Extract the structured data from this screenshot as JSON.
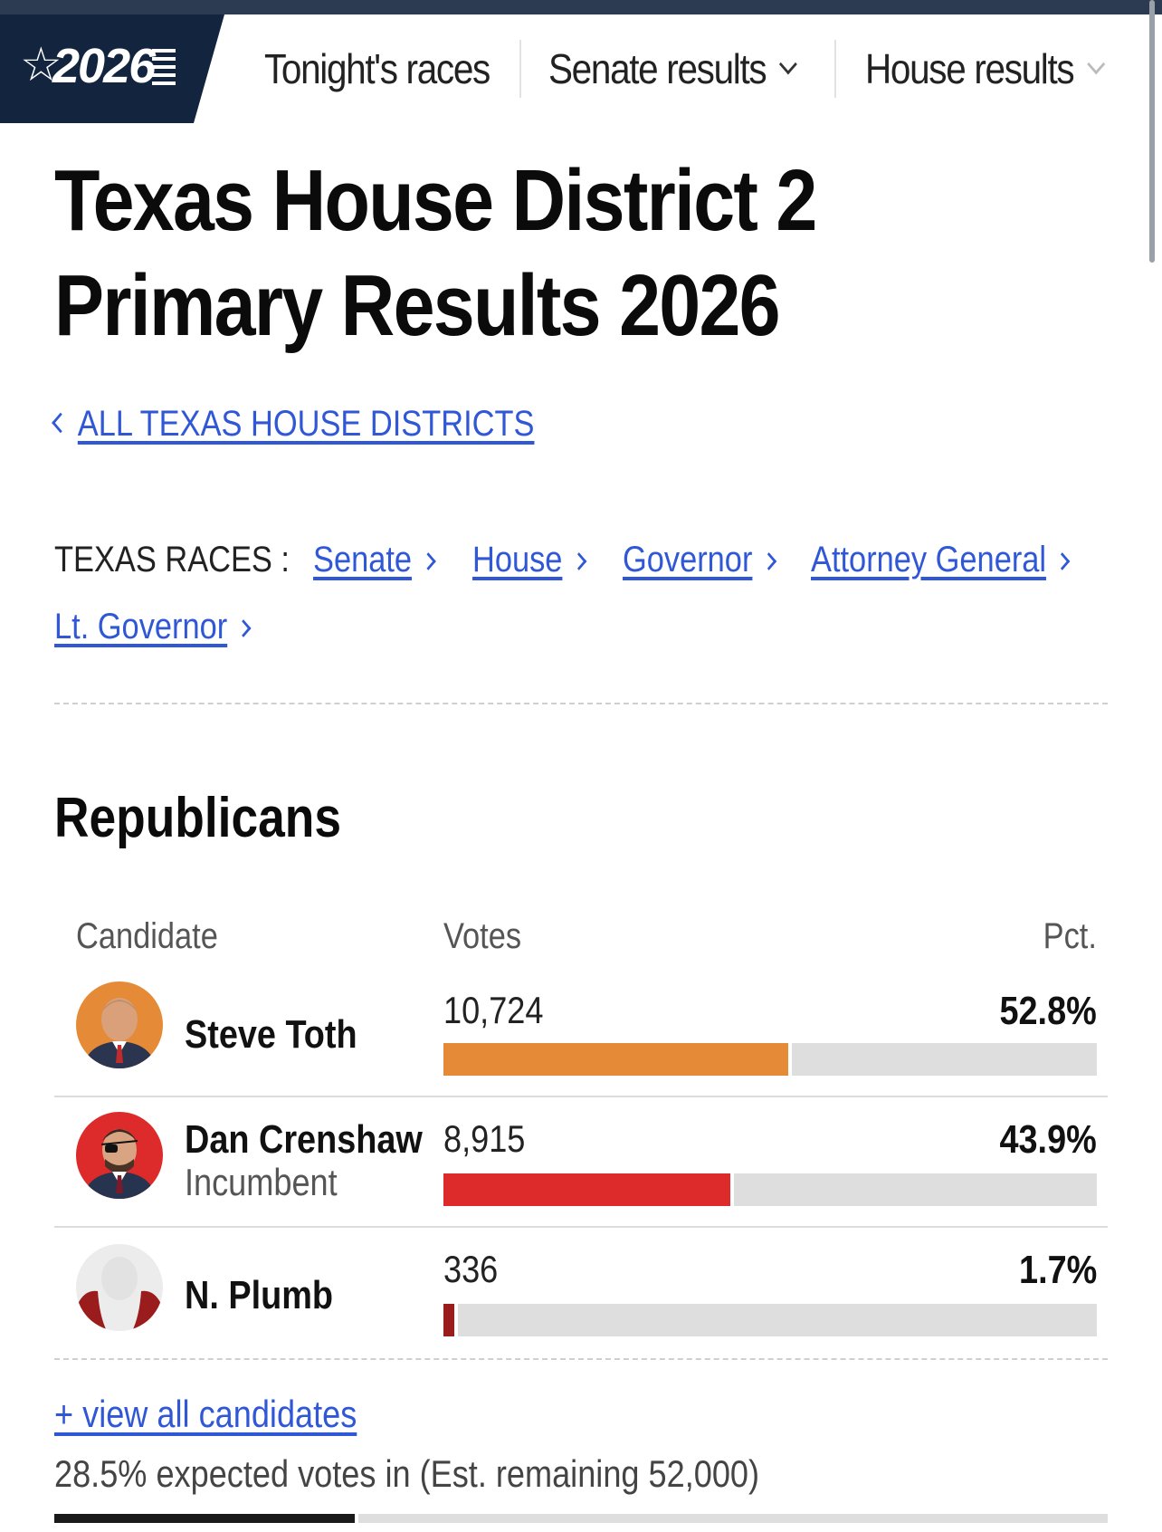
{
  "nav": {
    "logo_year": "2026",
    "items": [
      {
        "label": "Tonight's races"
      },
      {
        "label": "Senate results"
      },
      {
        "label": "House results"
      }
    ]
  },
  "page": {
    "title_line1": "Texas House District 2",
    "title_line2": "Primary Results 2026",
    "back_link": "ALL TEXAS HOUSE DISTRICTS"
  },
  "races": {
    "label": "TEXAS RACES :",
    "links": [
      "Senate",
      "House",
      "Governor",
      "Attorney General",
      "Lt. Governor"
    ]
  },
  "results": {
    "party": "Republicans",
    "headers": {
      "candidate": "Candidate",
      "votes": "Votes",
      "pct": "Pct."
    },
    "candidates": [
      {
        "name": "Steve Toth",
        "subtitle": "",
        "votes": "10,724",
        "pct": "52.8%",
        "share": 0.528,
        "color": "#e58a36"
      },
      {
        "name": "Dan Crenshaw",
        "subtitle": "Incumbent",
        "votes": "8,915",
        "pct": "43.9%",
        "share": 0.439,
        "color": "#dd2a2a"
      },
      {
        "name": "N. Plumb",
        "subtitle": "",
        "votes": "336",
        "pct": "1.7%",
        "share": 0.017,
        "color": "#9b1c1c"
      }
    ],
    "view_all": "+ view all candidates",
    "expected": "28.5% expected votes in (Est. remaining 52,000)",
    "expected_share": 0.285
  },
  "colors": {
    "nav_bg": "#13243f",
    "link": "#2f57d6",
    "bar_track": "#dedede"
  }
}
